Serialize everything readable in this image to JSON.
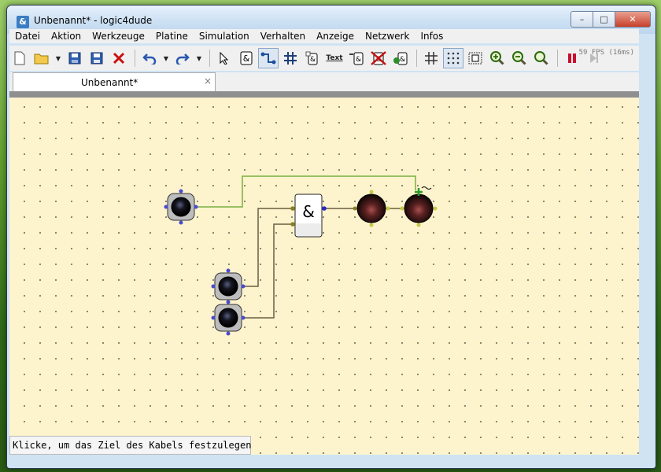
{
  "window": {
    "title": "Unbenannt* - logic4dude",
    "app_icon_glyph": "&",
    "minimize_glyph": "–",
    "maximize_glyph": "□",
    "close_glyph": "✕"
  },
  "menu": {
    "items": [
      "Datei",
      "Aktion",
      "Werkzeuge",
      "Platine",
      "Simulation",
      "Verhalten",
      "Anzeige",
      "Netzwerk",
      "Infos"
    ]
  },
  "toolbar": {
    "fps": "59 FPS (16ms)",
    "icons": [
      "new-icon",
      "open-icon",
      "save-icon",
      "save-as-icon",
      "delete-icon",
      "undo-icon",
      "redo-icon",
      "select-icon",
      "and-gate-icon",
      "wire-tool-icon",
      "junction-icon",
      "component-icon",
      "text-icon",
      "insert-gate-icon",
      "remove-gate-icon",
      "macro-icon",
      "grid-icon",
      "dot-grid-icon",
      "fit-icon",
      "zoom-in-icon",
      "zoom-out-icon",
      "zoom-reset-icon",
      "pause-icon",
      "step-icon"
    ],
    "text_tool_label": "Text"
  },
  "tabs": [
    {
      "label": "Unbenannt*",
      "close_glyph": "×"
    }
  ],
  "canvas": {
    "and_gate_symbol": "&",
    "components": [
      "input-switch-1",
      "input-switch-2",
      "input-switch-3",
      "and-gate",
      "output-lamp-1",
      "output-lamp-2"
    ],
    "colors": {
      "background": "#fdf3cd",
      "wire_active": "#78b040",
      "wire": "#6a6040"
    }
  },
  "status": {
    "text": "Klicke, um das Ziel des Kabels festzulegen"
  }
}
